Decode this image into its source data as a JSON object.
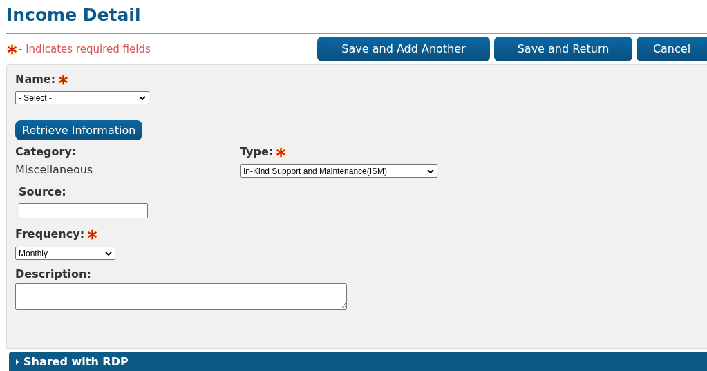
{
  "page_title": "Income Detail",
  "required_legend": "- Indicates required fields",
  "buttons": [
    {
      "label": "Save and Add Another"
    },
    {
      "label": "Save and Return"
    },
    {
      "label": "Cancel"
    }
  ],
  "form": {
    "name": {
      "label": "Name:",
      "required": true,
      "value": "- Select -"
    },
    "retrieve_button": "Retrieve Information",
    "category": {
      "label": "Category:",
      "value": "Miscellaneous"
    },
    "type": {
      "label": "Type:",
      "required": true,
      "value": "In-Kind Support and Maintenance(ISM)"
    },
    "source": {
      "label": "Source:",
      "required": false
    },
    "frequency": {
      "label": "Frequency:",
      "required": true,
      "value": "Monthly"
    },
    "description": {
      "label": "Description:",
      "required": false
    }
  },
  "sections": [
    {
      "title": "Shared with RDP",
      "expanded": false
    }
  ]
}
